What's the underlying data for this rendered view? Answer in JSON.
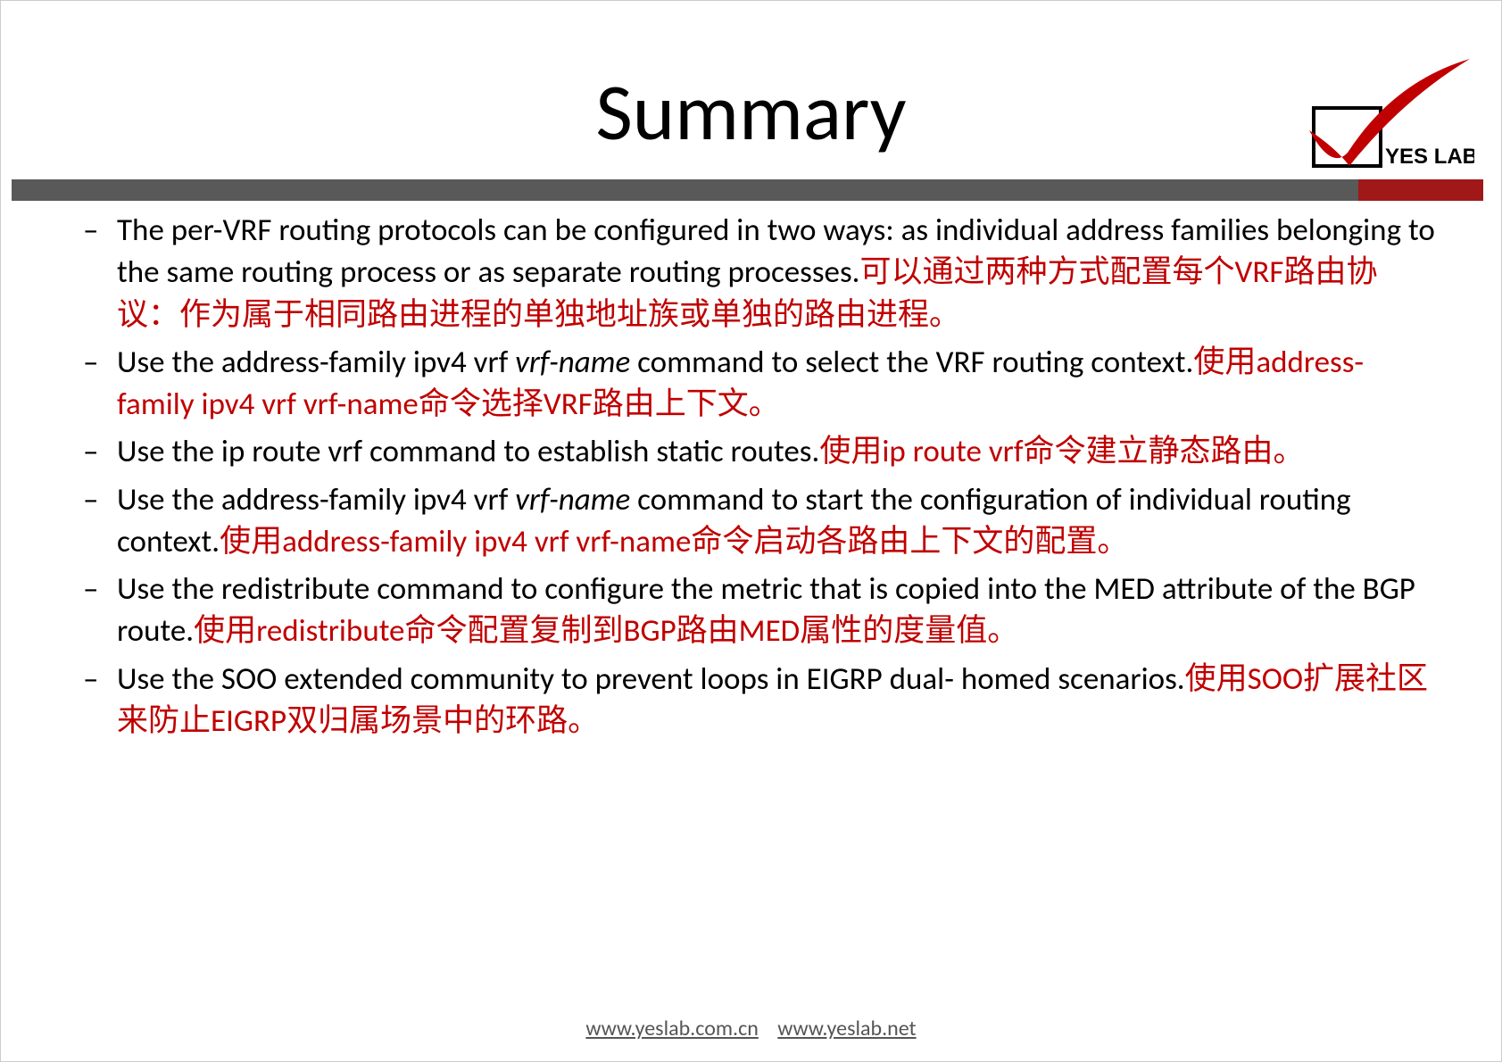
{
  "title": "Summary",
  "logo_text": "YES LAB",
  "bullets": [
    {
      "en_a": "The per-VRF routing protocols can be configured in two ways: as  individual address families belonging to the same routing process  or as separate routing processes.",
      "cn": "可以通过两种方式配置每个VRF路由协议：作为属于相同路由进程的单独地址族或单独的路由进程。"
    },
    {
      "en_a": "Use the address-family ipv4 vrf ",
      "it": "vrf-name",
      "en_b": " command to select the  VRF routing context.",
      "cn": "使用address-family ipv4 vrf vrf-name命令选择VRF路由上下文。"
    },
    {
      "en_a": "Use the ip route vrf command to establish static routes.",
      "cn": "使用ip route vrf命令建立静态路由。"
    },
    {
      "en_a": "Use the address-family ipv4 vrf ",
      "it": "vrf-name",
      "en_b": " command to start the configuration of individual routing context.",
      "cn": "使用address-family ipv4 vrf vrf-name命令启动各路由上下文的配置。"
    },
    {
      "en_a": "Use the redistribute command to configure the metric that is  copied into the MED attribute of the BGP route.",
      "cn": "使用redistribute命令配置复制到BGP路由MED属性的度量值。"
    },
    {
      "en_a": "Use the SOO extended community to prevent loops in EIGRP dual-  homed scenarios.",
      "cn": "使用SOO扩展社区来防止EIGRP双归属场景中的环路。"
    }
  ],
  "footer_link1": "www.yeslab.com.cn",
  "footer_link2": "www.yeslab.net"
}
